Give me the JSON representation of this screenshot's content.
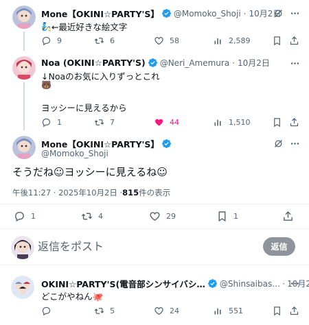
{
  "tweets": [
    {
      "name": "Mone【OKINI☆PARTY'S】",
      "handle": "@Momoko_Shoji",
      "sep": "·",
      "date": "10月2日",
      "text_prefix_emoji": "🧞",
      "text": "←最近好きな絵文字",
      "replies": "9",
      "retweets": "6",
      "likes": "58",
      "views": "2,589"
    },
    {
      "name": "Noa (OKINI☆PARTY'S)",
      "handle": "@Neri_Amemura",
      "sep": "·",
      "date": "10月2日",
      "line1": "↓Noaのお気に入りずっとこれ",
      "emoji": "🐻",
      "line2": "ヨッシーに見えるから",
      "replies": "1",
      "retweets": "7",
      "likes": "44",
      "views": "1,510"
    }
  ],
  "main_tweet": {
    "name": "Mone【OKINI☆PARTY'S】",
    "handle": "@Momoko_Shoji",
    "text": "そうだね☺ヨッシーに見えるね☺",
    "timestamp": "午後11:27 · 2025年10月2日 · ",
    "views_count": "815",
    "views_label": " 件の表示",
    "replies": "1",
    "retweets": "4",
    "likes": "29",
    "bookmarks": "1"
  },
  "reply_box": {
    "placeholder": "返信をポスト",
    "button_label": "返信"
  },
  "bottom_tweet": {
    "name": "OKINI☆PARTY'S(電音部シンサイバシ…",
    "handle": "@Shinsaibas…",
    "sep": "·",
    "date": "10月2日",
    "text": "どこがやねん🐙",
    "retweets": "5",
    "likes": "24",
    "views": "551"
  },
  "colors": {
    "verified": "#1d9bf0",
    "like_active": "#f91880",
    "muted": "#536471",
    "reply_button": "#8e9499"
  }
}
